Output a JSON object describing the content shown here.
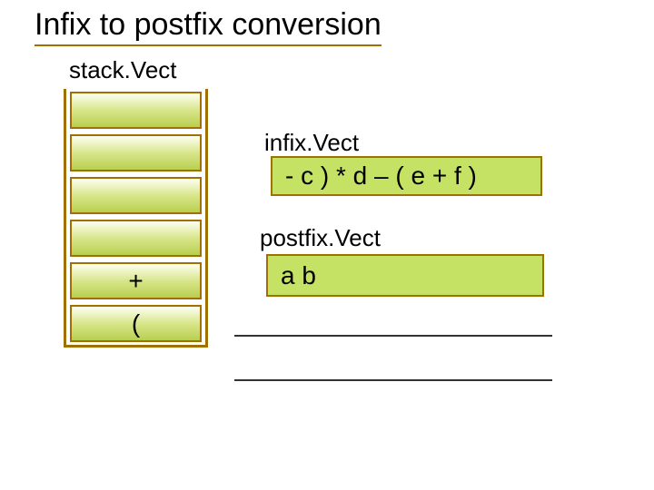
{
  "title": "Infix to postfix conversion",
  "stack": {
    "label": "stack.Vect",
    "cells": [
      "",
      "",
      "",
      "",
      "+",
      "("
    ]
  },
  "infix": {
    "label": "infix.Vect",
    "value": "- c ) * d – ( e + f )"
  },
  "postfix": {
    "label": "postfix.Vect",
    "value": "a b"
  }
}
